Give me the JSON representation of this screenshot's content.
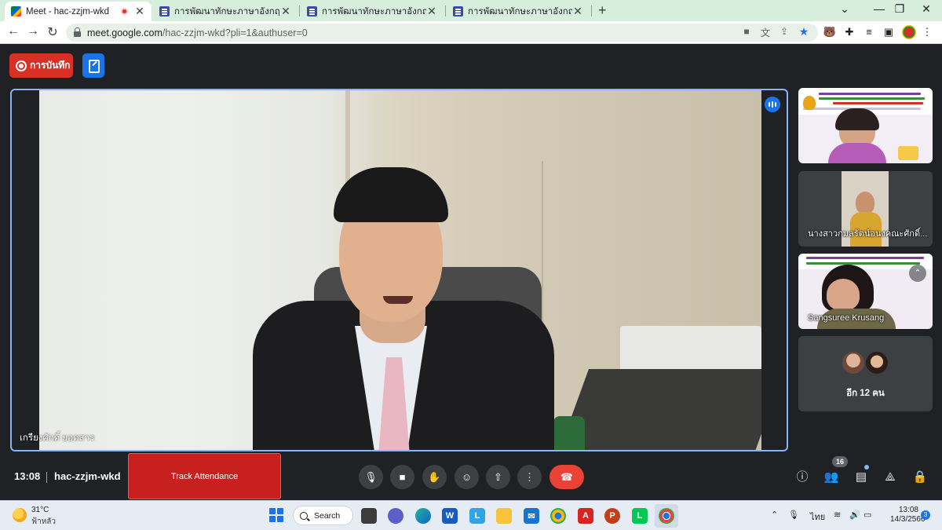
{
  "browser": {
    "tabs": [
      {
        "title": "Meet - hac-zzjm-wkd",
        "active": true,
        "recording": true
      },
      {
        "title": "การพัฒนาทักษะภาษาอังกฤษ English",
        "active": false
      },
      {
        "title": "การพัฒนาทักษะภาษาอังกฤษ English",
        "active": false
      },
      {
        "title": "การพัฒนาทักษะภาษาอังกฤษ English",
        "active": false
      }
    ],
    "url_host": "meet.google.com",
    "url_path": "/hac-zzjm-wkd?pli=1&authuser=0",
    "icons": [
      "back-icon",
      "forward-icon",
      "reload-icon",
      "camera-icon",
      "translate-icon",
      "share-icon",
      "star-icon",
      "extension-icon",
      "puzzle-icon",
      "media-icon",
      "sidepanel-icon",
      "profile-icon",
      "menu-icon"
    ]
  },
  "meet": {
    "record_label": "การบันทึก",
    "main_speaker": "เกรียงศักดิ์ ยอดสาร",
    "participants": [
      {
        "name": ""
      },
      {
        "name": "นางสาวกมลรัตน์อนงคณะศักดิ์..."
      },
      {
        "name": "Sangsuree Krusang"
      }
    ],
    "more_label": "อีก 12 คน",
    "time": "13:08",
    "meeting_code": "hac-zzjm-wkd",
    "track_attendance": "Track Attendance",
    "people_count": "16",
    "colors": {
      "end_call": "#ea4335",
      "record": "#d93025",
      "track": "#c8201e",
      "accent": "#1a73e8"
    }
  },
  "taskbar": {
    "temperature": "31°C",
    "weather": "ฟ้าหลัว",
    "search_label": "Search",
    "lang": "ไทย",
    "clock_time": "13:08",
    "clock_date": "14/3/2566",
    "notifications": "3"
  }
}
